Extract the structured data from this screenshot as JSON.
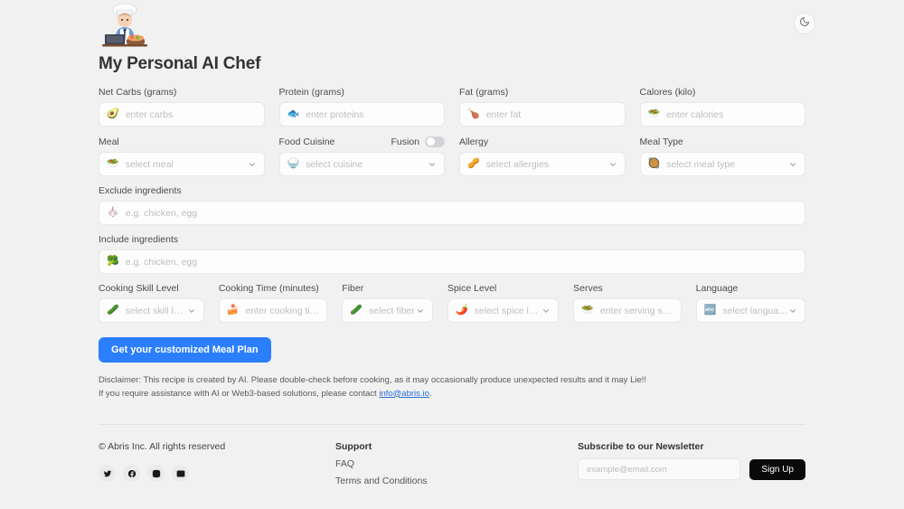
{
  "header": {
    "logo_alt": "ai-chef-illustration",
    "title": "My Personal AI Chef",
    "theme_toggle_icon": "moon-icon"
  },
  "form": {
    "rows": [
      {
        "fields": [
          {
            "label": "Net Carbs (grams)",
            "placeholder": "enter carbs",
            "icon": "🥑",
            "icon_name": "avocado-icon",
            "type": "input",
            "name": "net-carbs"
          },
          {
            "label": "Protein (grams)",
            "placeholder": "enter proteins",
            "icon": "🐟",
            "icon_name": "fish-icon",
            "type": "input",
            "name": "protein"
          },
          {
            "label": "Fat (grams)",
            "placeholder": "enter fat",
            "icon": "🍗",
            "icon_name": "meat-icon",
            "type": "input",
            "name": "fat"
          },
          {
            "label": "Calores (kilo)",
            "placeholder": "enter calories",
            "icon": "🥗",
            "icon_name": "salad-icon",
            "type": "input",
            "name": "calories"
          }
        ]
      },
      {
        "fields": [
          {
            "label": "Meal",
            "placeholder": "select meal",
            "icon": "🥗",
            "icon_name": "bowl-icon",
            "type": "select",
            "name": "meal"
          },
          {
            "label": "Food Cuisine",
            "placeholder": "select cuisine",
            "icon": "🍚",
            "icon_name": "cuisine-icon",
            "type": "select",
            "name": "food-cuisine",
            "toggle": {
              "label": "Fusion",
              "on": false
            }
          },
          {
            "label": "Allergy",
            "placeholder": "select allergies",
            "icon": "🥜",
            "icon_name": "peanut-icon",
            "type": "select",
            "name": "allergy"
          },
          {
            "label": "Meal Type",
            "placeholder": "select meal type",
            "icon": "🥘",
            "icon_name": "pan-icon",
            "type": "select",
            "name": "meal-type"
          }
        ]
      }
    ],
    "exclude": {
      "label": "Exclude ingredients",
      "placeholder": "e.g. chicken, egg",
      "icon": "🧄",
      "icon_name": "garlic-icon",
      "type": "input",
      "name": "exclude-ingredients"
    },
    "include": {
      "label": "Include ingredients",
      "placeholder": "e.g. chicken, egg",
      "icon": "🥦",
      "icon_name": "broccoli-icon",
      "type": "input",
      "name": "include-ingredients"
    },
    "bottom_row": [
      {
        "label": "Cooking Skill Level",
        "placeholder": "select skill level",
        "icon": "🥒",
        "icon_name": "cucumber-icon",
        "type": "select",
        "name": "cooking-skill-level",
        "flex": 1.3
      },
      {
        "label": "Cooking Time (minutes)",
        "placeholder": "enter cooking time",
        "icon": "🍰",
        "icon_name": "cake-icon",
        "type": "input",
        "name": "cooking-time",
        "flex": 1.34
      },
      {
        "label": "Fiber",
        "placeholder": "select fiber",
        "icon": "🥒",
        "icon_name": "pickle-icon",
        "type": "select",
        "name": "fiber",
        "flex": 1.12
      },
      {
        "label": "Spice Level",
        "placeholder": "select spice level",
        "icon": "🌶️",
        "icon_name": "chili-icon",
        "type": "select",
        "name": "spice-level",
        "flex": 1.37
      },
      {
        "label": "Serves",
        "placeholder": "enter serving size",
        "icon": "🥗",
        "icon_name": "serving-icon",
        "type": "input",
        "name": "serves",
        "flex": 1.33
      },
      {
        "label": "Language",
        "placeholder": "select language",
        "icon": "🔤",
        "icon_name": "language-icon",
        "type": "select",
        "name": "language",
        "flex": 1.35
      }
    ],
    "submit_label": "Get your customized Meal Plan"
  },
  "disclaimer": {
    "line1": "Disclaimer: This recipe is created by AI. Please double-check before cooking, as it may occasionally produce unexpected results and it may Lie!!",
    "line2_before": "If you require assistance with AI or Web3-based solutions, please contact ",
    "line2_link": "info@abris.io",
    "line2_after": "."
  },
  "footer": {
    "copyright": "© Abris Inc. All rights reserved",
    "socials": [
      {
        "name": "twitter-icon"
      },
      {
        "name": "facebook-icon"
      },
      {
        "name": "instagram-icon"
      },
      {
        "name": "email-icon"
      }
    ],
    "support_heading": "Support",
    "support_links": [
      "FAQ",
      "Terms and Conditions"
    ],
    "newsletter_heading": "Subscribe to our Newsletter",
    "newsletter_placeholder": "example@email.com",
    "newsletter_value": "",
    "signup_label": "Sign Up"
  },
  "colors": {
    "background": "#f1f1f1",
    "accent": "#2b7fff",
    "link": "#2b6ed6",
    "signup_bg": "#0a0a0a"
  }
}
